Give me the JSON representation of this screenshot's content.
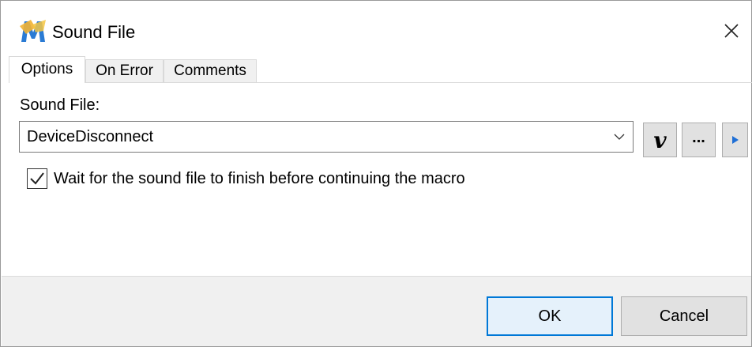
{
  "window": {
    "title": "Sound File",
    "close_icon": "close-icon",
    "app_icon": "macro-app-icon"
  },
  "tabs": [
    {
      "label": "Options",
      "active": true
    },
    {
      "label": "On Error",
      "active": false
    },
    {
      "label": "Comments",
      "active": false
    }
  ],
  "options": {
    "sound_file_label": "Sound File:",
    "sound_file_value": "DeviceDisconnect",
    "variable_button_label": "v",
    "browse_button_label": "...",
    "play_icon": "play-icon",
    "wait_checkbox_checked": true,
    "wait_checkbox_label": "Wait for the sound file to finish before continuing the macro"
  },
  "footer": {
    "ok_label": "OK",
    "cancel_label": "Cancel"
  },
  "colors": {
    "accent": "#0078d7",
    "play_arrow": "#1f6fd6",
    "button_bg": "#e1e1e1",
    "footer_bg": "#f0f0f0"
  }
}
